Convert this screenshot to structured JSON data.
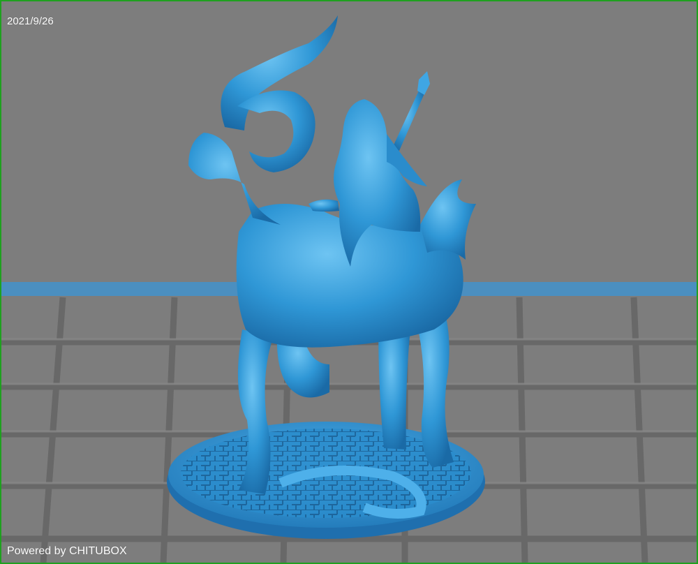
{
  "viewer": {
    "date": "2021/9/26",
    "powered_by": "Powered by CHITUBOX"
  },
  "scene": {
    "model": "goat-rider-miniature",
    "colors": {
      "frame": "#1fa01f",
      "background": "#7d7d7d",
      "plate_grid": "#666666",
      "plate_edge": "#4b8fc0",
      "model": "#2f97d6"
    }
  }
}
